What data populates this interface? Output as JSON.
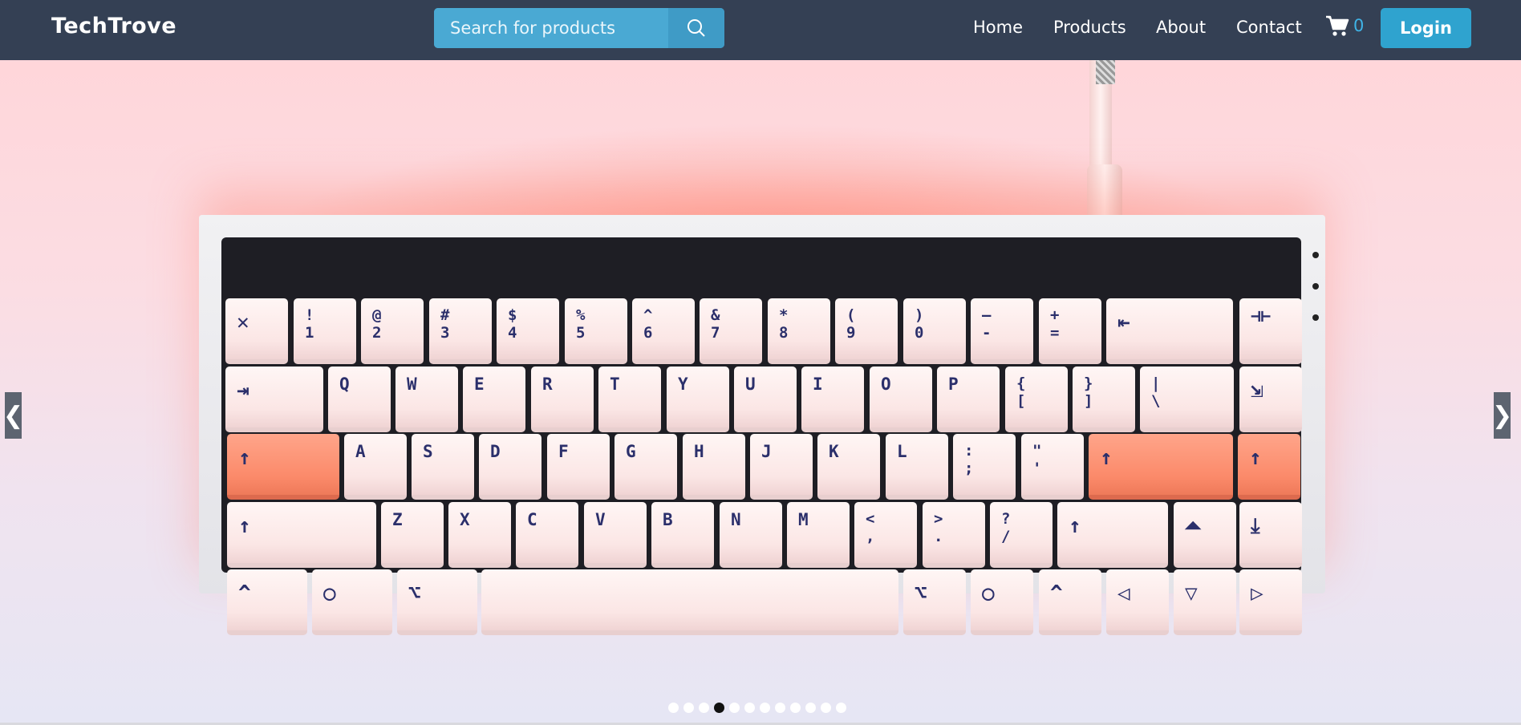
{
  "brand": "TechTrove",
  "search": {
    "placeholder": "Search for products",
    "icon": "search-icon"
  },
  "nav": {
    "home": "Home",
    "products": "Products",
    "about": "About",
    "contact": "Contact"
  },
  "cart": {
    "icon": "cart-icon",
    "count": "0"
  },
  "login_label": "Login",
  "colors": {
    "navbar": "#344054",
    "accent": "#2fa3cf",
    "search_bg": "#4aa9d3"
  },
  "carousel": {
    "image": "Mechanical keyboard with pink and orange keycaps on pink background",
    "prev_arrow": "❮",
    "next_arrow": "❯",
    "slide_count": 12,
    "active_slide": 4
  },
  "keyboard": {
    "row1": [
      "✕",
      "!\n1",
      "@\n2",
      "#\n3",
      "$\n4",
      "%\n5",
      "^\n6",
      "&\n7",
      "*\n8",
      "(\n9",
      ")\n0",
      "–\n-",
      "+\n=",
      "⇤",
      "⊣⊢"
    ],
    "row2": [
      "⇥",
      "Q",
      "W",
      "E",
      "R",
      "T",
      "Y",
      "U",
      "I",
      "O",
      "P",
      "{\n[",
      "}\n]",
      "|\n\\",
      "⇲"
    ],
    "row3": [
      "↑",
      "A",
      "S",
      "D",
      "F",
      "G",
      "H",
      "J",
      "K",
      "L",
      ":\n;",
      "\"\n'",
      "↑",
      "↑"
    ],
    "row4": [
      "↑",
      "Z",
      "X",
      "C",
      "V",
      "B",
      "N",
      "M",
      "<\n,",
      ">\n.",
      "?\n/",
      "↑",
      "⏶",
      "⤓"
    ],
    "row5": [
      "^",
      "○",
      "⌥",
      "",
      "⌥",
      "○",
      "^",
      "◁",
      "▽",
      "▷"
    ]
  }
}
